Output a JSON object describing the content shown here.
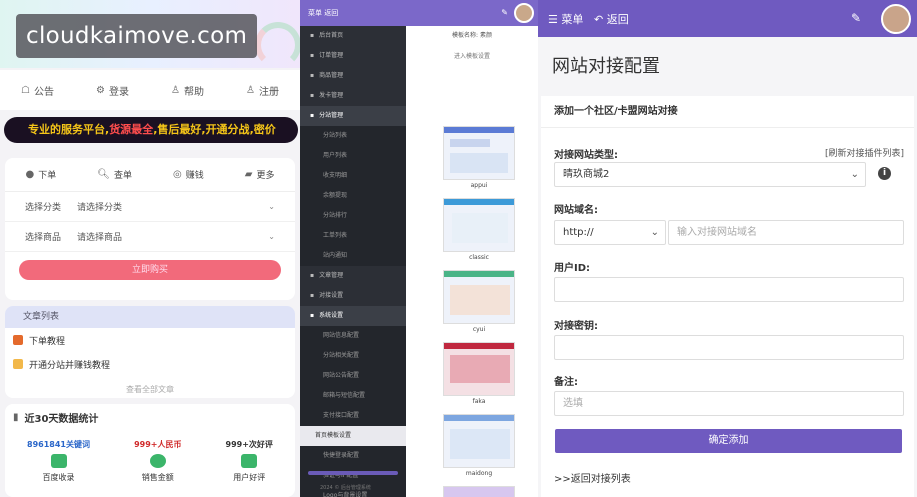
{
  "left": {
    "watermark": "cloudkaimove.com",
    "topnav": [
      {
        "icon": "announce-icon",
        "label": "公告"
      },
      {
        "icon": "login-icon",
        "label": "登录"
      },
      {
        "icon": "help-icon",
        "label": "帮助"
      },
      {
        "icon": "register-icon",
        "label": "注册"
      }
    ],
    "ticker": [
      "专业的服务平台,",
      "货源最全",
      "售后最好",
      "开通分战",
      "密价"
    ],
    "tabs": [
      {
        "icon": "order-icon",
        "label": "下单"
      },
      {
        "icon": "search-icon",
        "label": "查单"
      },
      {
        "icon": "coin-icon",
        "label": "赚钱"
      },
      {
        "icon": "more-icon",
        "label": "更多"
      }
    ],
    "category": {
      "label": "选择分类",
      "value": "请选择分类"
    },
    "product": {
      "label": "选择商品",
      "value": "请选择商品"
    },
    "buy_button": "立即购买",
    "articles_title": "文章列表",
    "articles": [
      "下单教程",
      "开通分站并赚钱教程"
    ],
    "articles_more": "查看全部文章",
    "stats_title": "近30天数据统计",
    "stats": [
      {
        "value": "8961841关键词",
        "caption": "百度收录",
        "color": "#2a66c9"
      },
      {
        "value": "999+人民币",
        "caption": "销售金额",
        "color": "#d02a2a"
      },
      {
        "value": "999+次好评",
        "caption": "用户好评",
        "color": "#333"
      }
    ]
  },
  "mid": {
    "header": "菜单  返回",
    "menu": [
      {
        "label": "后台首页",
        "type": "top"
      },
      {
        "label": "订单管理",
        "type": "top"
      },
      {
        "label": "商品管理",
        "type": "top"
      },
      {
        "label": "发卡管理",
        "type": "top"
      },
      {
        "label": "分站管理",
        "type": "act"
      },
      {
        "label": "分站列表",
        "type": "sub"
      },
      {
        "label": "用户列表",
        "type": "sub"
      },
      {
        "label": "收支明细",
        "type": "sub"
      },
      {
        "label": "余额提现",
        "type": "sub"
      },
      {
        "label": "分站排行",
        "type": "sub"
      },
      {
        "label": "工单列表",
        "type": "sub"
      },
      {
        "label": "站内通知",
        "type": "sub"
      },
      {
        "label": "文章管理",
        "type": "top"
      },
      {
        "label": "对接设置",
        "type": "top"
      },
      {
        "label": "系统设置",
        "type": "act"
      },
      {
        "label": "网站信息配置",
        "type": "sub"
      },
      {
        "label": "分站相关配置",
        "type": "sub"
      },
      {
        "label": "网站公告配置",
        "type": "sub"
      },
      {
        "label": "邮箱与短信配置",
        "type": "sub"
      },
      {
        "label": "支付接口配置",
        "type": "sub"
      },
      {
        "label": "首页模板设置",
        "type": "sel"
      },
      {
        "label": "快捷登录配置",
        "type": "sub"
      },
      {
        "label": "验证与IP配置",
        "type": "sub"
      },
      {
        "label": "Logo与背景设置",
        "type": "sub"
      }
    ],
    "copyright": "2024 © 后台管理系统",
    "template_name": "模板名称: 素颜",
    "template_link": "进入模板设置",
    "templates": [
      "appui",
      "classic",
      "cyui",
      "faka",
      "maidong"
    ]
  },
  "right": {
    "menu_label": "菜单",
    "back_label": "返回",
    "page_title": "网站对接配置",
    "form_header": "添加一个社区/卡盟网站对接",
    "site_type_label": "对接网站类型:",
    "refresh_link": "[刷新对接插件列表]",
    "site_type_value": "晴玖商城2",
    "domain_label": "网站域名:",
    "protocol": "http://",
    "domain_placeholder": "输入对接网站域名",
    "userid_label": "用户ID:",
    "secret_label": "对接密钥:",
    "note_label": "备注:",
    "note_placeholder": "选填",
    "submit": "确定添加",
    "back_list": ">>返回对接列表"
  }
}
